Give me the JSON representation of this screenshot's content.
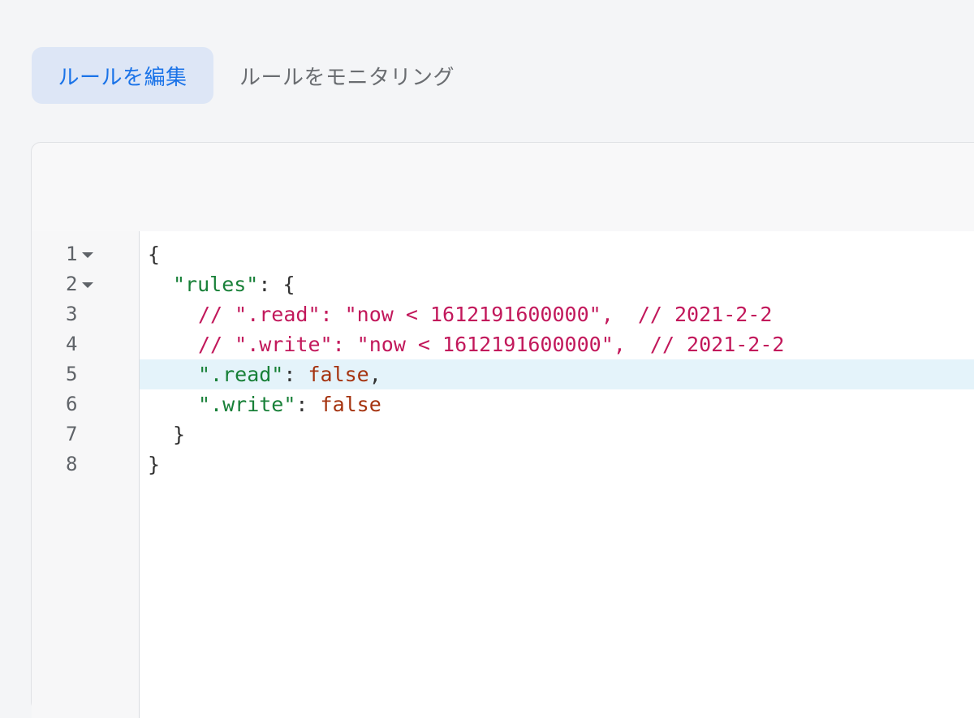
{
  "tabs": [
    {
      "label": "ルールを編集",
      "active": true
    },
    {
      "label": "ルールをモニタリング",
      "active": false
    }
  ],
  "editor": {
    "line_numbers": [
      "1",
      "2",
      "3",
      "4",
      "5",
      "6",
      "7",
      "8"
    ],
    "foldable_lines": [
      "1",
      "2"
    ],
    "active_line": "5",
    "lines": [
      {
        "indent": "",
        "tokens": [
          {
            "t": "{",
            "k": "punc"
          }
        ]
      },
      {
        "indent": "  ",
        "tokens": [
          {
            "t": "\"rules\"",
            "k": "key"
          },
          {
            "t": ": {",
            "k": "punc"
          }
        ]
      },
      {
        "indent": "    ",
        "tokens": [
          {
            "t": "// \".read\": \"now < 1612191600000\",  // 2021-2-2",
            "k": "comment"
          }
        ]
      },
      {
        "indent": "    ",
        "tokens": [
          {
            "t": "// \".write\": \"now < 1612191600000\",  // 2021-2-2",
            "k": "comment"
          }
        ]
      },
      {
        "indent": "    ",
        "tokens": [
          {
            "t": "\".read\"",
            "k": "key"
          },
          {
            "t": ": ",
            "k": "punc"
          },
          {
            "t": "false",
            "k": "bool"
          },
          {
            "t": ",",
            "k": "punc"
          }
        ]
      },
      {
        "indent": "    ",
        "tokens": [
          {
            "t": "\".write\"",
            "k": "key"
          },
          {
            "t": ": ",
            "k": "punc"
          },
          {
            "t": "false",
            "k": "bool"
          }
        ]
      },
      {
        "indent": "  ",
        "tokens": [
          {
            "t": "}",
            "k": "punc"
          }
        ]
      },
      {
        "indent": "",
        "tokens": [
          {
            "t": "}",
            "k": "punc"
          }
        ]
      }
    ]
  }
}
